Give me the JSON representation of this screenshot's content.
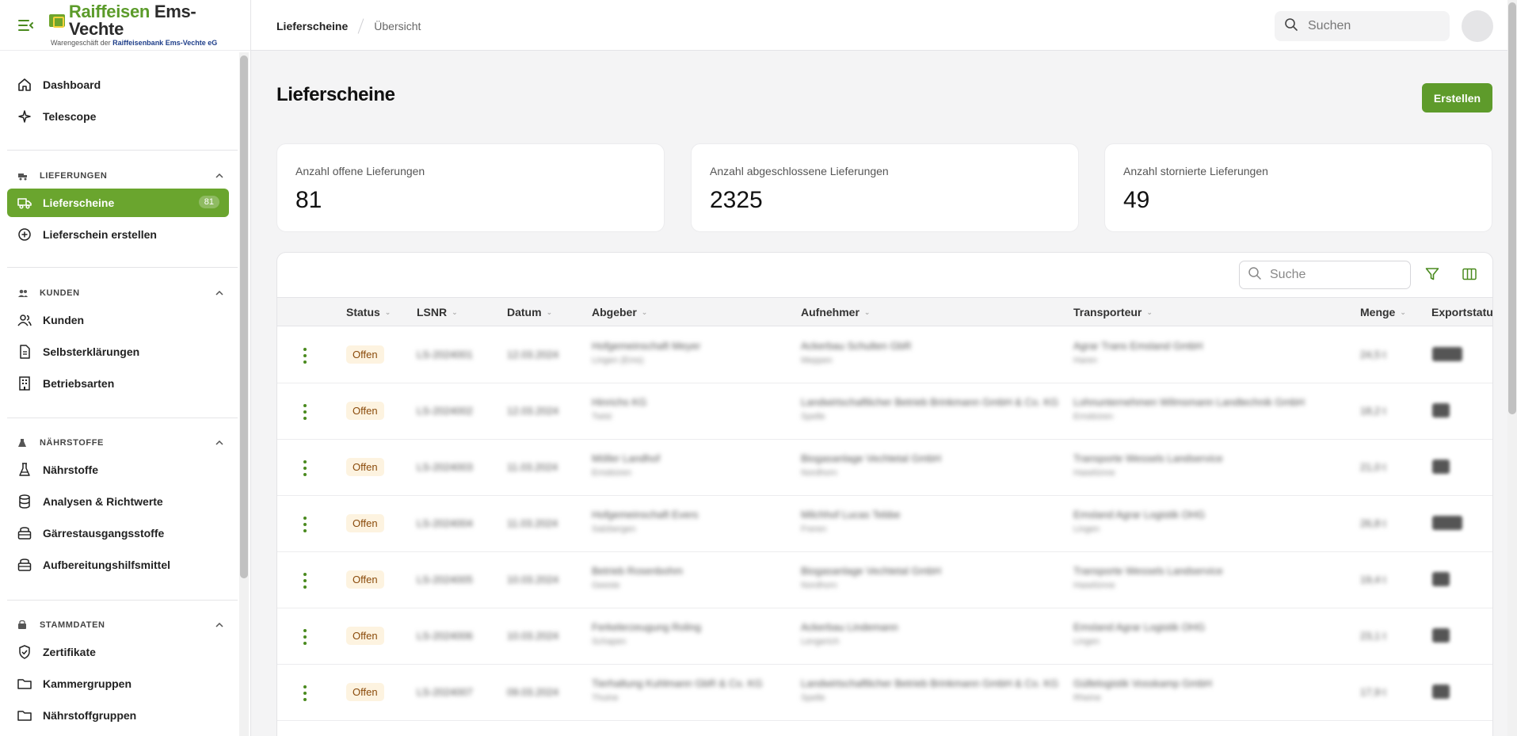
{
  "brand": {
    "name_green": "Raiffeisen",
    "name_dark": "Ems-Vechte",
    "subtitle_prefix": "Warengeschäft der",
    "subtitle_bank": "Raiffeisenbank Ems-Vechte eG"
  },
  "breadcrumb": {
    "current": "Lieferscheine",
    "next": "Übersicht"
  },
  "top_search": {
    "placeholder": "Suchen"
  },
  "sidebar": {
    "top_items": [
      {
        "label": "Dashboard",
        "icon": "home-icon"
      },
      {
        "label": "Telescope",
        "icon": "sparkle-icon"
      }
    ],
    "sections": [
      {
        "title": "LIEFERUNGEN",
        "items": [
          {
            "label": "Lieferscheine",
            "badge": "81",
            "active": true
          },
          {
            "label": "Lieferschein erstellen"
          }
        ]
      },
      {
        "title": "KUNDEN",
        "items": [
          {
            "label": "Kunden"
          },
          {
            "label": "Selbsterklärungen"
          },
          {
            "label": "Betriebsarten"
          }
        ]
      },
      {
        "title": "NÄHRSTOFFE",
        "items": [
          {
            "label": "Nährstoffe"
          },
          {
            "label": "Analysen & Richtwerte"
          },
          {
            "label": "Gärrestausgangsstoffe"
          },
          {
            "label": "Aufbereitungshilfsmittel"
          }
        ]
      },
      {
        "title": "STAMMDATEN",
        "items": [
          {
            "label": "Zertifikate"
          },
          {
            "label": "Kammergruppen"
          },
          {
            "label": "Nährstoffgruppen"
          }
        ]
      }
    ]
  },
  "page": {
    "title": "Lieferscheine",
    "create_label": "Erstellen"
  },
  "stats": [
    {
      "label": "Anzahl offene Lieferungen",
      "value": "81"
    },
    {
      "label": "Anzahl abgeschlossene Lieferungen",
      "value": "2325"
    },
    {
      "label": "Anzahl stornierte Lieferungen",
      "value": "49"
    }
  ],
  "table": {
    "search_placeholder": "Suche",
    "columns": [
      "Status",
      "LSNR",
      "Datum",
      "Abgeber",
      "Aufnehmer",
      "Transporteur",
      "Menge",
      "Exportstatus"
    ],
    "rows": [
      {
        "status": "Offen",
        "lsnr": "LS-2024001",
        "datum": "12.03.2024",
        "abgeber": "Hofgemeinschaft Meyer",
        "abgeber_sub": "Lingen (Ems)",
        "aufnehmer": "Ackerbau Schulten GbR",
        "aufnehmer_sub": "Meppen",
        "transporteur": "Agrar Trans Emsland GmbH",
        "transporteur_sub": "Haren",
        "menge": "24,5 t"
      },
      {
        "status": "Offen",
        "lsnr": "LS-2024002",
        "datum": "12.03.2024",
        "abgeber": "Hinrichs KG",
        "abgeber_sub": "Twist",
        "aufnehmer": "Landwirtschaftlicher Betrieb Brinkmann GmbH & Co. KG",
        "aufnehmer_sub": "Spelle",
        "transporteur": "Lohnunternehmen Wilmsmann Landtechnik GmbH",
        "transporteur_sub": "Emsbüren",
        "menge": "18,2 t"
      },
      {
        "status": "Offen",
        "lsnr": "LS-2024003",
        "datum": "11.03.2024",
        "abgeber": "Möller Landhof",
        "abgeber_sub": "Emsbüren",
        "aufnehmer": "Biogasanlage Vechtetal GmbH",
        "aufnehmer_sub": "Nordhorn",
        "transporteur": "Transporte Wessels Landservice",
        "transporteur_sub": "Haselünne",
        "menge": "21,0 t"
      },
      {
        "status": "Offen",
        "lsnr": "LS-2024004",
        "datum": "11.03.2024",
        "abgeber": "Hofgemeinschaft Evers",
        "abgeber_sub": "Salzbergen",
        "aufnehmer": "Milchhof Lucas Tebbe",
        "aufnehmer_sub": "Freren",
        "transporteur": "Emsland Agrar Logistik OHG",
        "transporteur_sub": "Lingen",
        "menge": "26,8 t"
      },
      {
        "status": "Offen",
        "lsnr": "LS-2024005",
        "datum": "10.03.2024",
        "abgeber": "Betrieb Rosenbohm",
        "abgeber_sub": "Geeste",
        "aufnehmer": "Biogasanlage Vechtetal GmbH",
        "aufnehmer_sub": "Nordhorn",
        "transporteur": "Transporte Wessels Landservice",
        "transporteur_sub": "Haselünne",
        "menge": "19,4 t"
      },
      {
        "status": "Offen",
        "lsnr": "LS-2024006",
        "datum": "10.03.2024",
        "abgeber": "Ferkelerzeugung Roling",
        "abgeber_sub": "Schapen",
        "aufnehmer": "Ackerbau Lindemann",
        "aufnehmer_sub": "Lengerich",
        "transporteur": "Emsland Agrar Logistik OHG",
        "transporteur_sub": "Lingen",
        "menge": "23,1 t"
      },
      {
        "status": "Offen",
        "lsnr": "LS-2024007",
        "datum": "09.03.2024",
        "abgeber": "Tierhaltung Kuhlmann GbR & Co. KG",
        "abgeber_sub": "Thuine",
        "aufnehmer": "Landwirtschaftlicher Betrieb Brinkmann GmbH & Co. KG",
        "aufnehmer_sub": "Spelle",
        "transporteur": "Güllelogistik Vosskamp GmbH",
        "transporteur_sub": "Rheine",
        "menge": "17,9 t"
      }
    ]
  }
}
